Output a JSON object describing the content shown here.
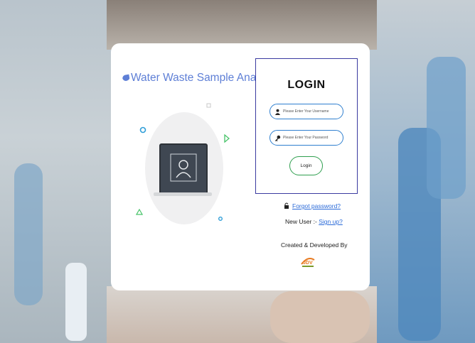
{
  "brand": {
    "title": "Water Waste Sample Analysis",
    "color": "#5e7fd6"
  },
  "login": {
    "title": "LOGIN",
    "username_placeholder": "Please Enter Your Username",
    "password_placeholder": "Please Enter Your Password",
    "button_label": "Login"
  },
  "links": {
    "forgot_password": "Forgot password?",
    "new_user_label": "New User",
    "signup": "Sign up?"
  },
  "footer": {
    "credit": "Created & Developed By"
  },
  "icons": [
    "water-drop-icon",
    "user-icon",
    "key-icon",
    "lock-icon",
    "user-avatar-icon",
    "company-logo-icon"
  ],
  "colors": {
    "field_border": "#2f7fcf",
    "button_border": "#2f9f4f",
    "box_border": "#3a3aa0",
    "link": "#2a6ad8"
  }
}
